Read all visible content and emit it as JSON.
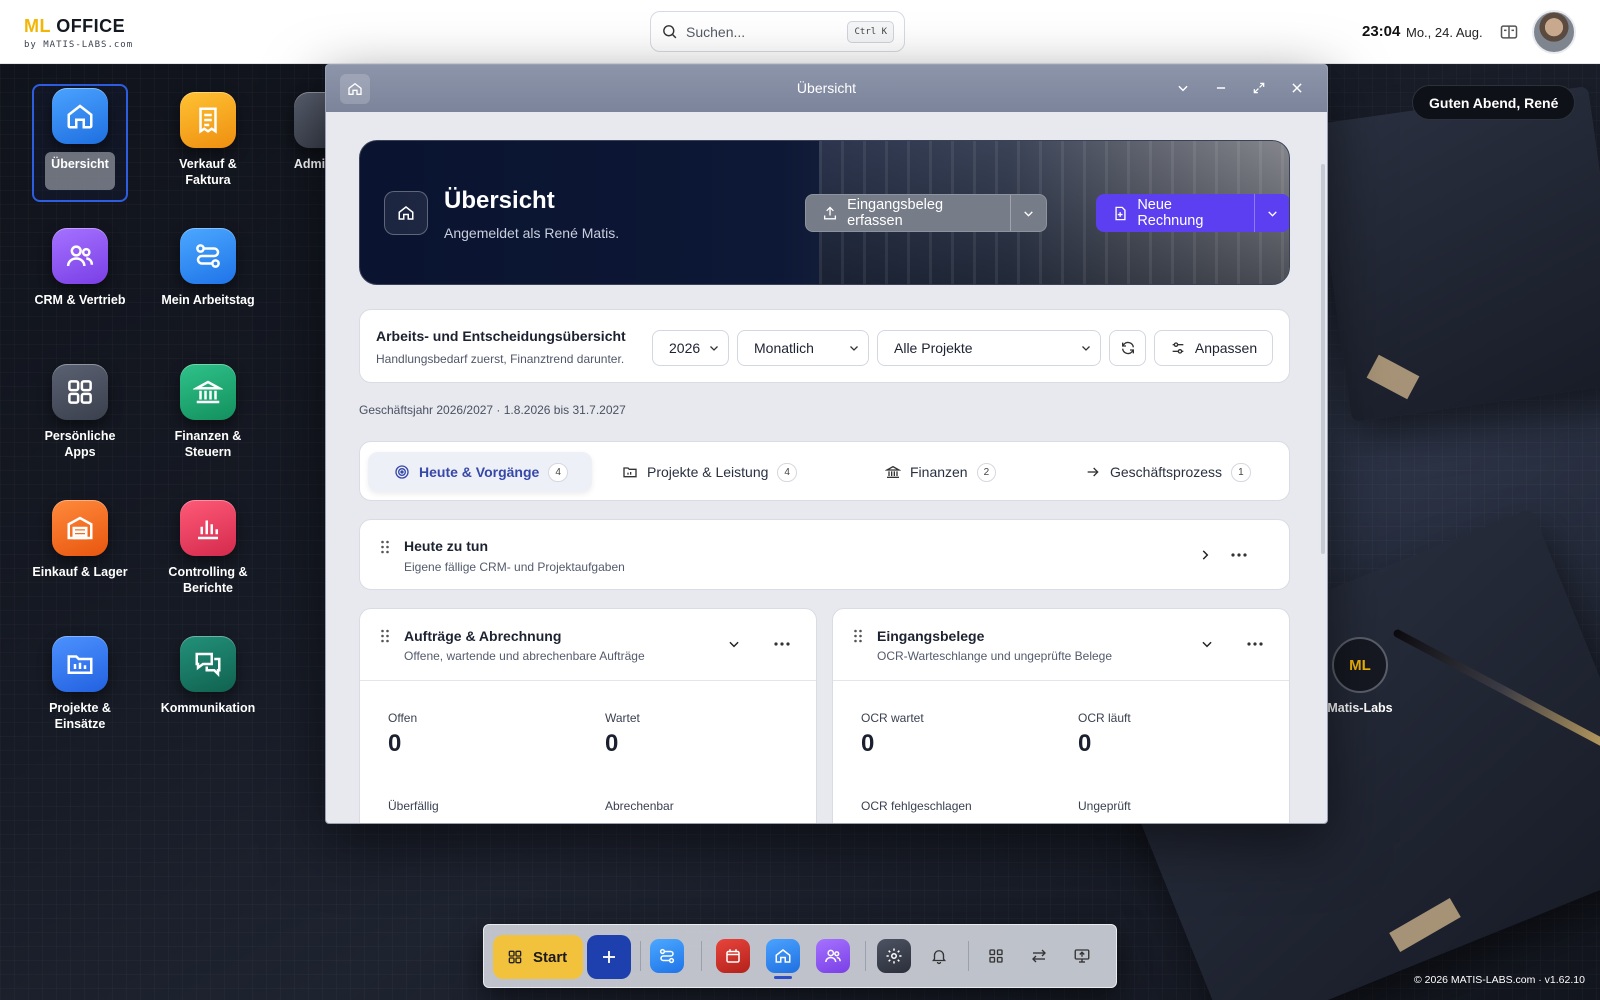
{
  "topbar": {
    "brand_ml": "ML",
    "brand_office": "OFFICE",
    "brand_sub": "by MATIS-LABS.com",
    "search_placeholder": "Suchen...",
    "search_shortcut": "Ctrl K",
    "time": "23:04",
    "date": "Mo., 24. Aug."
  },
  "greeting": "Guten Abend, René",
  "desktop_icons": [
    {
      "label": "Übersicht",
      "icon": "home-icon",
      "color": "#2f86f0",
      "selected": true
    },
    {
      "label": "Verkauf & Faktura",
      "icon": "receipt-icon",
      "color": "#f0a21a"
    },
    {
      "label": "Admi… &",
      "icon": "admin-icon",
      "color": "#4b5160"
    },
    {
      "label": "CRM & Vertrieb",
      "icon": "users-icon",
      "color": "#8a55ec"
    },
    {
      "label": "Mein Arbeitstag",
      "icon": "workflow-icon",
      "color": "#2f8df2"
    },
    {
      "label": "Persönliche Apps",
      "icon": "apps-grid-icon",
      "color": "#4d5363"
    },
    {
      "label": "Finanzen & Steuern",
      "icon": "bank-icon",
      "color": "#1fa775"
    },
    {
      "label": "Einkauf & Lager",
      "icon": "warehouse-icon",
      "color": "#f06b1e"
    },
    {
      "label": "Controlling & Berichte",
      "icon": "bar-chart-icon",
      "color": "#e33c5c"
    },
    {
      "label": "Projekte & Einsätze",
      "icon": "project-folder-icon",
      "color": "#3076ec"
    },
    {
      "label": "Kommunikation",
      "icon": "chat-icon",
      "color": "#167a63"
    }
  ],
  "corner_app": {
    "badge": "ML",
    "label": "Matis-Labs"
  },
  "window": {
    "title": "Übersicht",
    "hero": {
      "title": "Übersicht",
      "subtitle": "Angemeldet als René Matis.",
      "btn_receipt": "Eingangsbeleg erfassen",
      "btn_invoice": "Neue Rechnung"
    },
    "filter": {
      "title": "Arbeits- und Entscheidungsübersicht",
      "subtitle": "Handlungsbedarf zuerst, Finanztrend darunter.",
      "year": "2026",
      "period": "Monatlich",
      "project": "Alle Projekte",
      "customize": "Anpassen"
    },
    "fiscal_year": "Geschäftsjahr 2026/2027 · 1.8.2026 bis 31.7.2027",
    "tabs": [
      {
        "label": "Heute & Vorgänge",
        "count": "4",
        "icon": "target-icon",
        "active": true
      },
      {
        "label": "Projekte & Leistung",
        "count": "4",
        "icon": "folder-chart-icon"
      },
      {
        "label": "Finanzen",
        "count": "2",
        "icon": "bank-icon"
      },
      {
        "label": "Geschäftsprozess",
        "count": "1",
        "icon": "arrow-right-icon"
      }
    ],
    "today": {
      "title": "Heute zu tun",
      "subtitle": "Eigene fällige CRM- und Projektaufgaben"
    },
    "orders": {
      "title": "Aufträge & Abrechnung",
      "subtitle": "Offene, wartende und abrechenbare Aufträge",
      "stats": [
        {
          "label": "Offen",
          "value": "0"
        },
        {
          "label": "Wartet",
          "value": "0"
        },
        {
          "label": "Überfällig",
          "value": ""
        },
        {
          "label": "Abrechenbar",
          "value": ""
        }
      ]
    },
    "receipts": {
      "title": "Eingangsbelege",
      "subtitle": "OCR-Warteschlange und ungeprüfte Belege",
      "stats": [
        {
          "label": "OCR wartet",
          "value": "0"
        },
        {
          "label": "OCR läuft",
          "value": "0"
        },
        {
          "label": "OCR fehlgeschlagen",
          "value": ""
        },
        {
          "label": "Ungeprüft",
          "value": ""
        }
      ]
    }
  },
  "dock": {
    "start_label": "Start",
    "items": [
      "workflow-icon",
      "ml-calendar-icon",
      "home-icon",
      "users-icon",
      "settings-icon",
      "bell-icon",
      "apps-grid-icon",
      "switch-icon",
      "screen-share-icon"
    ]
  },
  "copyright": "© 2026 MATIS-LABS.com · v1.62.10"
}
